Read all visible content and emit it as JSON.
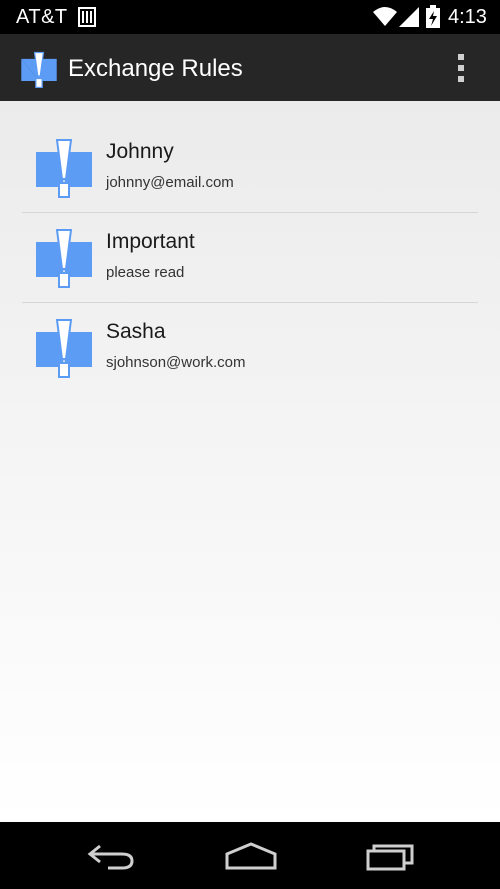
{
  "status_bar": {
    "carrier": "AT&T",
    "time": "4:13",
    "icons": [
      "sim-icon",
      "wifi-icon",
      "signal-icon",
      "battery-charging-icon"
    ]
  },
  "action_bar": {
    "title": "Exchange Rules",
    "icon": "exchange-rules-app-icon",
    "overflow_icon": "overflow-menu-icon"
  },
  "rules": [
    {
      "name": "Johnny",
      "detail": "johnny@email.com"
    },
    {
      "name": "Important",
      "detail": "please read"
    },
    {
      "name": "Sasha",
      "detail": "sjohnson@work.com"
    }
  ],
  "navigation": {
    "icons": [
      "back-icon",
      "home-icon",
      "recents-icon"
    ]
  },
  "colors": {
    "accent_blue": "#5d9cf5",
    "action_bar": "#262626",
    "status_bar": "#000000"
  }
}
